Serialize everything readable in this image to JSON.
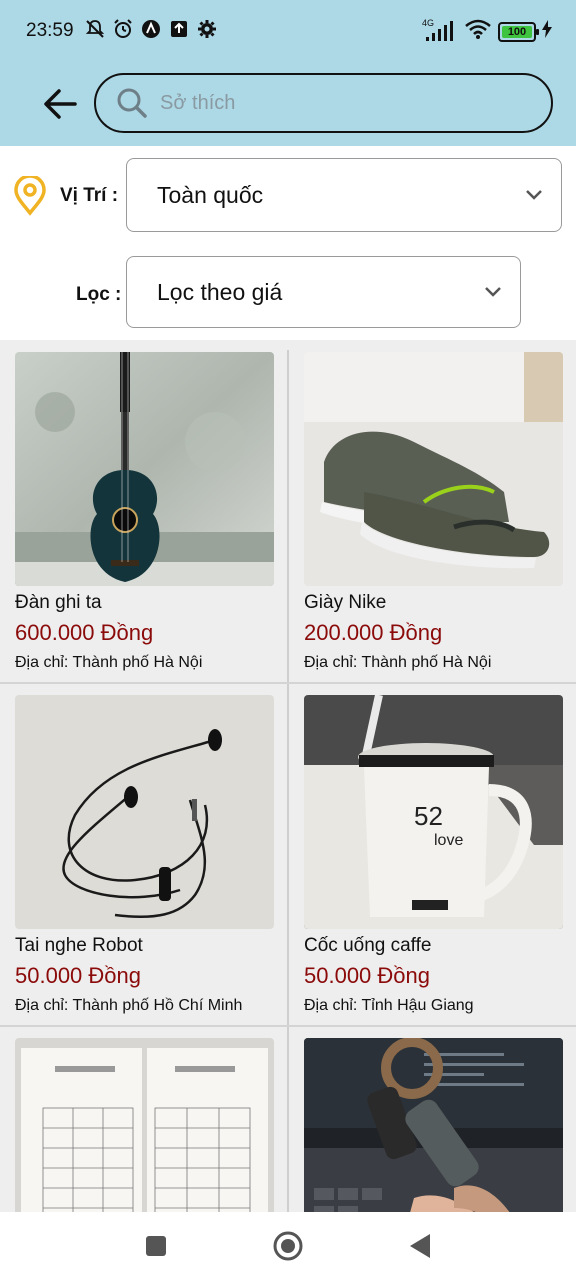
{
  "status_bar": {
    "time": "23:59",
    "network_type": "4G",
    "battery_level": "100",
    "icons": [
      "mute-icon",
      "alarm-icon",
      "app-icon",
      "upload-icon",
      "settings-icon",
      "signal-icon",
      "wifi-icon",
      "battery-icon",
      "charging-icon"
    ]
  },
  "header": {
    "search_placeholder": "Sở thích"
  },
  "filters": {
    "location_label": "Vị Trí :",
    "location_value": "Toàn quốc",
    "filter_label": "Lọc :",
    "filter_value": "Lọc theo giá"
  },
  "products": [
    {
      "name": "Đàn ghi ta",
      "price": "600.000 Đồng",
      "address": "Địa chỉ: Thành phố Hà Nội",
      "image": "guitar"
    },
    {
      "name": "Giày Nike",
      "price": "200.000 Đồng",
      "address": "Địa chỉ: Thành phố Hà Nội",
      "image": "shoes"
    },
    {
      "name": "Tai nghe Robot",
      "price": "50.000 Đồng",
      "address": "Địa chỉ: Thành phố Hồ Chí Minh",
      "image": "earphones"
    },
    {
      "name": "Cốc uống caffe",
      "price": "50.000 Đồng",
      "address": "Địa chỉ: Tỉnh Hậu Giang",
      "image": "mug"
    },
    {
      "name": "",
      "price": "",
      "address": "",
      "image": "sudoku-book"
    },
    {
      "name": "",
      "price": "",
      "address": "",
      "image": "hand-gripper"
    }
  ],
  "colors": {
    "header_bg": "#add8e6",
    "price": "#8b0a0a",
    "location_pin": "#f0b323"
  },
  "navigation": {
    "buttons": [
      "recent-apps-icon",
      "home-icon",
      "back-nav-icon"
    ]
  }
}
